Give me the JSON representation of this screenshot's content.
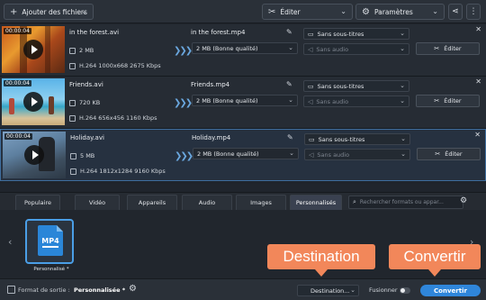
{
  "toolbar": {
    "add_files_label": "Ajouter des fichiers",
    "edit_label": "Éditer",
    "settings_label": "Paramètres"
  },
  "files": [
    {
      "time": "00:00:04",
      "name": "in the forest.avi",
      "size": "2 MB",
      "meta": "H.264 1000x668 2675 Kbps",
      "out_name": "in the forest.mp4",
      "out_size": "2 MB (Bonne qualité)",
      "subtitles": "Sans sous-titres",
      "audio": "Sans audio",
      "edit_label": "Éditer"
    },
    {
      "time": "00:00:04",
      "name": "Friends.avi",
      "size": "720 KB",
      "meta": "H.264 656x456 1160 Kbps",
      "out_name": "Friends.mp4",
      "out_size": "2 MB (Bonne qualité)",
      "subtitles": "Sans sous-titres",
      "audio": "Sans audio",
      "edit_label": "Éditer"
    },
    {
      "time": "00:00:04",
      "name": "Holiday.avi",
      "size": "5 MB",
      "meta": "H.264 1812x1284 9160 Kbps",
      "out_name": "Holiday.mp4",
      "out_size": "2 MB (Bonne qualité)",
      "subtitles": "Sans sous-titres",
      "audio": "Sans audio",
      "edit_label": "Éditer"
    }
  ],
  "tabs": [
    "Populaire",
    "Vidéo",
    "Appareils",
    "Audio",
    "Images",
    "Personnalisés"
  ],
  "active_tab": "Personnalisés",
  "search_placeholder": "Rechercher formats ou appar...",
  "preset": {
    "badge": "MP4",
    "label": "Personnalisé *"
  },
  "bottom": {
    "format_label": "Format de sortie :",
    "format_value": "Personnalisée *",
    "destination_label": "Destination...",
    "merge_label": "Fusionner :",
    "convert_label": "Convertir"
  },
  "callouts": {
    "destination": "Destination",
    "convert": "Convertir"
  },
  "colors": {
    "accent": "#2f86db",
    "callout": "#f2875a",
    "selection_border": "#3f6e9e"
  }
}
